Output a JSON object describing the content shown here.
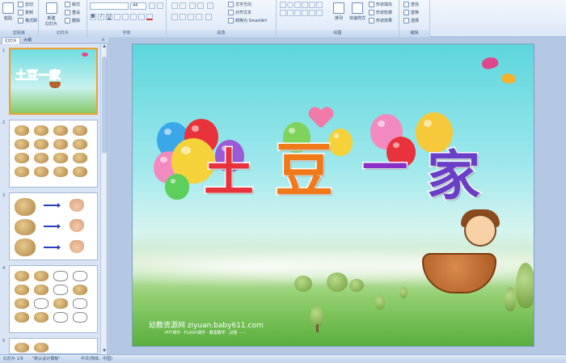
{
  "ribbon": {
    "clipboard": {
      "label": "剪贴板",
      "paste": "粘贴",
      "cut": "剪切",
      "copy": "复制",
      "format_painter": "格式刷"
    },
    "slides": {
      "label": "幻灯片",
      "new_slide": "新建\n幻灯片",
      "layout": "版式",
      "reset": "重设",
      "delete": "删除"
    },
    "font": {
      "label": "字体",
      "font_name": "",
      "font_size": "44"
    },
    "paragraph": {
      "label": "段落",
      "text_direction": "文字方向",
      "align_text": "对齐文本",
      "smartart": "转换为 SmartArt"
    },
    "drawing": {
      "label": "绘图",
      "arrange": "排列",
      "quick_styles": "快速样式",
      "shape_fill": "形状填充",
      "shape_outline": "形状轮廓",
      "shape_effects": "形状效果"
    },
    "editing": {
      "label": "编辑",
      "find": "查找",
      "replace": "替换",
      "select": "选择"
    }
  },
  "panel": {
    "tabs": [
      "幻灯片",
      "大纲"
    ],
    "close": "×",
    "thumbnails": [
      {
        "num": "1",
        "title": "土豆一家"
      },
      {
        "num": "2"
      },
      {
        "num": "3"
      },
      {
        "num": "4"
      },
      {
        "num": "5"
      }
    ]
  },
  "slide": {
    "title_chars": [
      "土",
      "豆",
      "一",
      "家"
    ],
    "watermark_main": "幼教资源网 ziyuan.baby611.com",
    "watermark_sub": "PPT课件 · FLASH课件 · 教案教学 · 试卷 ······"
  },
  "status": {
    "slide_info": "幻灯片 1/9",
    "theme": "\"默认设计模板\"",
    "language": "中文(简体，中国)"
  },
  "colors": {
    "title_chars": [
      "#e8323c",
      "#f07a1a",
      "#8b2fc9",
      "#6a3fc8"
    ],
    "selected_border": "#f0a030"
  }
}
